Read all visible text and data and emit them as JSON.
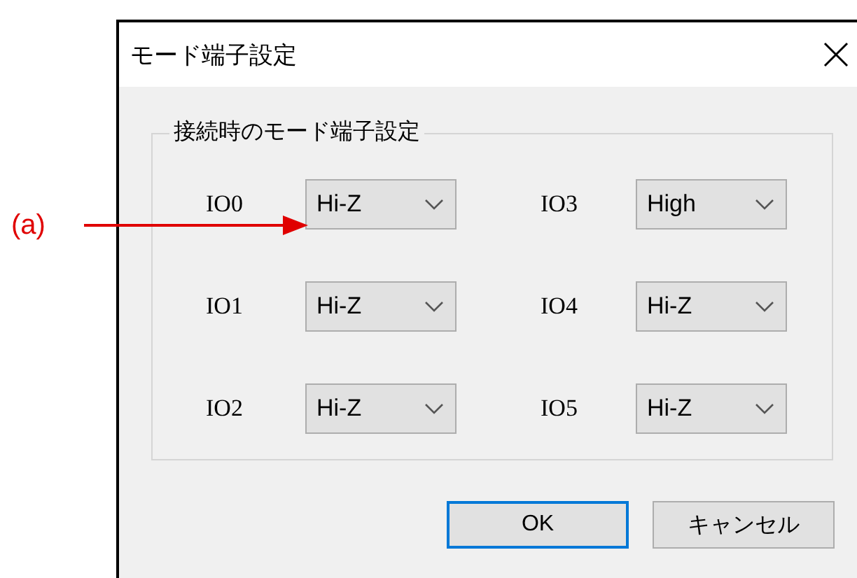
{
  "annotation": {
    "label": "(a)"
  },
  "window": {
    "title": "モード端子設定"
  },
  "group": {
    "title": "接続時のモード端子設定"
  },
  "pins": [
    {
      "label": "IO0",
      "value": "Hi-Z"
    },
    {
      "label": "IO1",
      "value": "Hi-Z"
    },
    {
      "label": "IO2",
      "value": "Hi-Z"
    },
    {
      "label": "IO3",
      "value": "High"
    },
    {
      "label": "IO4",
      "value": "Hi-Z"
    },
    {
      "label": "IO5",
      "value": "Hi-Z"
    }
  ],
  "buttons": [
    {
      "label": "OK",
      "default": true
    },
    {
      "label": "キャンセル",
      "default": false
    }
  ]
}
